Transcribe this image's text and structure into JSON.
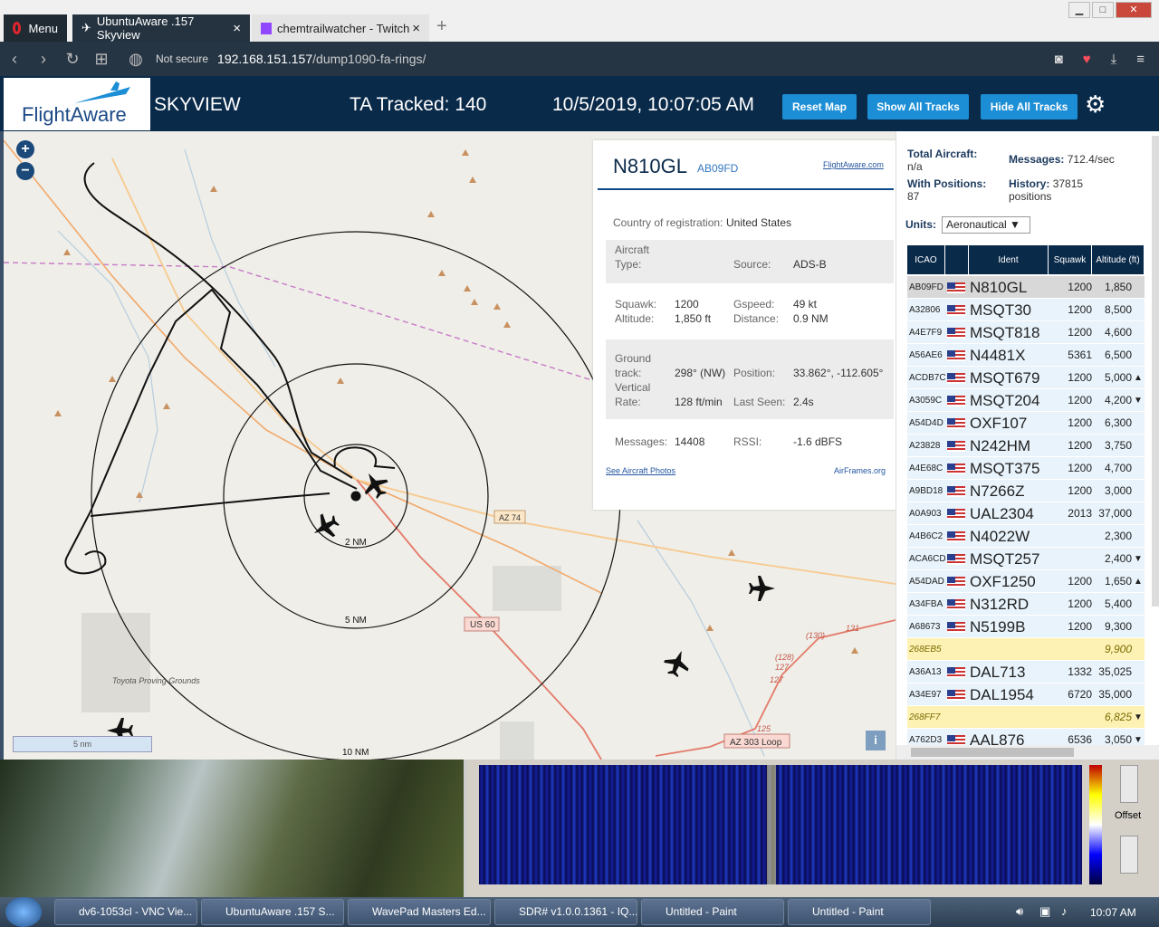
{
  "browser": {
    "menu_label": "Menu",
    "tabs": [
      {
        "label": "UbuntuAware .157 Skyview",
        "close": "×"
      },
      {
        "label": "chemtrailwatcher - Twitch",
        "close": "×"
      }
    ],
    "new_tab": "+",
    "security": "Not secure",
    "url_host": "192.168.151.157",
    "url_path": "/dump1090-fa-rings/"
  },
  "header": {
    "logo_text": "FlightAware",
    "title": "SKYVIEW",
    "tracked": "TA Tracked: 140",
    "datetime": "10/5/2019, 10:07:05 AM",
    "buttons": {
      "reset": "Reset Map",
      "show": "Show All Tracks",
      "hide": "Hide All Tracks"
    },
    "gear_icon": "gear-icon"
  },
  "map": {
    "zoom_in": "+",
    "zoom_out": "−",
    "ring_labels": [
      "2 NM",
      "5 NM",
      "10 NM"
    ],
    "road_labels": [
      "AZ 74",
      "US 60",
      "AZ 303 Loop"
    ],
    "route_numbers": [
      "(130)",
      "131",
      "(128)",
      "127",
      "127",
      "125"
    ],
    "place_label": "Toyota Proving Grounds",
    "scale_label": "5 nm",
    "info_label": "i"
  },
  "selected": {
    "ident": "N810GL",
    "icao": "AB09FD",
    "flightaware_link": "FlightAware.com",
    "country_label": "Country of registration:",
    "country_value": "United States",
    "aircraft_type_label1": "Aircraft",
    "aircraft_type_label2": "Type:",
    "source_label": "Source:",
    "source_value": "ADS-B",
    "squawk_label": "Squawk:",
    "squawk_value": "1200",
    "gspeed_label": "Gspeed:",
    "gspeed_value": "49 kt",
    "altitude_label": "Altitude:",
    "altitude_value": "1,850 ft",
    "distance_label": "Distance:",
    "distance_value": "0.9 NM",
    "ground_label1": "Ground",
    "ground_label2": "track:",
    "ground_value": "298° (NW)",
    "position_label": "Position:",
    "position_value": "33.862°, -112.605°",
    "vrate_label1": "Vertical",
    "vrate_label2": "Rate:",
    "vrate_value": "128 ft/min",
    "lastseen_label": "Last Seen:",
    "lastseen_value": "2.4s",
    "messages_label": "Messages:",
    "messages_value": "14408",
    "rssi_label": "RSSI:",
    "rssi_value": "-1.6 dBFS",
    "photos_link": "See Aircraft Photos",
    "airframes_link": "AirFrames.org"
  },
  "stats": {
    "total_label": "Total Aircraft:",
    "total_value": "n/a",
    "positions_label": "With Positions:",
    "positions_value": "87",
    "messages_label": "Messages:",
    "messages_value": "712.4/sec",
    "history_label": "History:",
    "history_value": "37815",
    "history_unit": "positions",
    "units_label": "Units:",
    "units_value": "Aeronautical ▼"
  },
  "table": {
    "headers": [
      "ICAO",
      "",
      "Ident",
      "Squawk",
      "Altitude (ft)"
    ],
    "rows": [
      {
        "icao": "AB09FD",
        "ident": "N810GL",
        "squawk": "1200",
        "alt": "1,850",
        "trend": "",
        "style": "sel"
      },
      {
        "icao": "A32806",
        "ident": "MSQT30",
        "squawk": "1200",
        "alt": "8,500",
        "trend": "",
        "style": ""
      },
      {
        "icao": "A4E7F9",
        "ident": "MSQT818",
        "squawk": "1200",
        "alt": "4,600",
        "trend": "",
        "style": ""
      },
      {
        "icao": "A56AE6",
        "ident": "N4481X",
        "squawk": "5361",
        "alt": "6,500",
        "trend": "",
        "style": ""
      },
      {
        "icao": "ACDB7C",
        "ident": "MSQT679",
        "squawk": "1200",
        "alt": "5,000",
        "trend": "▲",
        "style": ""
      },
      {
        "icao": "A3059C",
        "ident": "MSQT204",
        "squawk": "1200",
        "alt": "4,200",
        "trend": "▼",
        "style": ""
      },
      {
        "icao": "A54D4D",
        "ident": "OXF107",
        "squawk": "1200",
        "alt": "6,300",
        "trend": "",
        "style": ""
      },
      {
        "icao": "A23828",
        "ident": "N242HM",
        "squawk": "1200",
        "alt": "3,750",
        "trend": "",
        "style": ""
      },
      {
        "icao": "A4E68C",
        "ident": "MSQT375",
        "squawk": "1200",
        "alt": "4,700",
        "trend": "",
        "style": ""
      },
      {
        "icao": "A9BD18",
        "ident": "N7266Z",
        "squawk": "1200",
        "alt": "3,000",
        "trend": "",
        "style": ""
      },
      {
        "icao": "A0A903",
        "ident": "UAL2304",
        "squawk": "2013",
        "alt": "37,000",
        "trend": "",
        "style": ""
      },
      {
        "icao": "A4B6C2",
        "ident": "N4022W",
        "squawk": "",
        "alt": "2,300",
        "trend": "",
        "style": ""
      },
      {
        "icao": "ACA6CD",
        "ident": "MSQT257",
        "squawk": "",
        "alt": "2,400",
        "trend": "▼",
        "style": ""
      },
      {
        "icao": "A54DAD",
        "ident": "OXF1250",
        "squawk": "1200",
        "alt": "1,650",
        "trend": "▲",
        "style": ""
      },
      {
        "icao": "A34FBA",
        "ident": "N312RD",
        "squawk": "1200",
        "alt": "5,400",
        "trend": "",
        "style": ""
      },
      {
        "icao": "A68673",
        "ident": "N5199B",
        "squawk": "1200",
        "alt": "9,300",
        "trend": "",
        "style": ""
      },
      {
        "icao": "268EB5",
        "ident": "",
        "squawk": "",
        "alt": "9,900",
        "trend": "",
        "style": "warn"
      },
      {
        "icao": "A36A13",
        "ident": "DAL713",
        "squawk": "1332",
        "alt": "35,025",
        "trend": "",
        "style": ""
      },
      {
        "icao": "A34E97",
        "ident": "DAL1954",
        "squawk": "6720",
        "alt": "35,000",
        "trend": "",
        "style": ""
      },
      {
        "icao": "268FF7",
        "ident": "",
        "squawk": "",
        "alt": "6,825",
        "trend": "▼",
        "style": "warn"
      },
      {
        "icao": "A762D3",
        "ident": "AAL876",
        "squawk": "6536",
        "alt": "3,050",
        "trend": "▼",
        "style": ""
      }
    ]
  },
  "sdr": {
    "offset_label": "Offset"
  },
  "taskbar": {
    "items": [
      "dv6-1053cl - VNC Vie...",
      "UbuntuAware .157 S...",
      "WavePad Masters Ed...",
      "SDR# v1.0.0.1361 - IQ...",
      "Untitled - Paint",
      "Untitled - Paint"
    ],
    "time": "10:07 AM"
  }
}
